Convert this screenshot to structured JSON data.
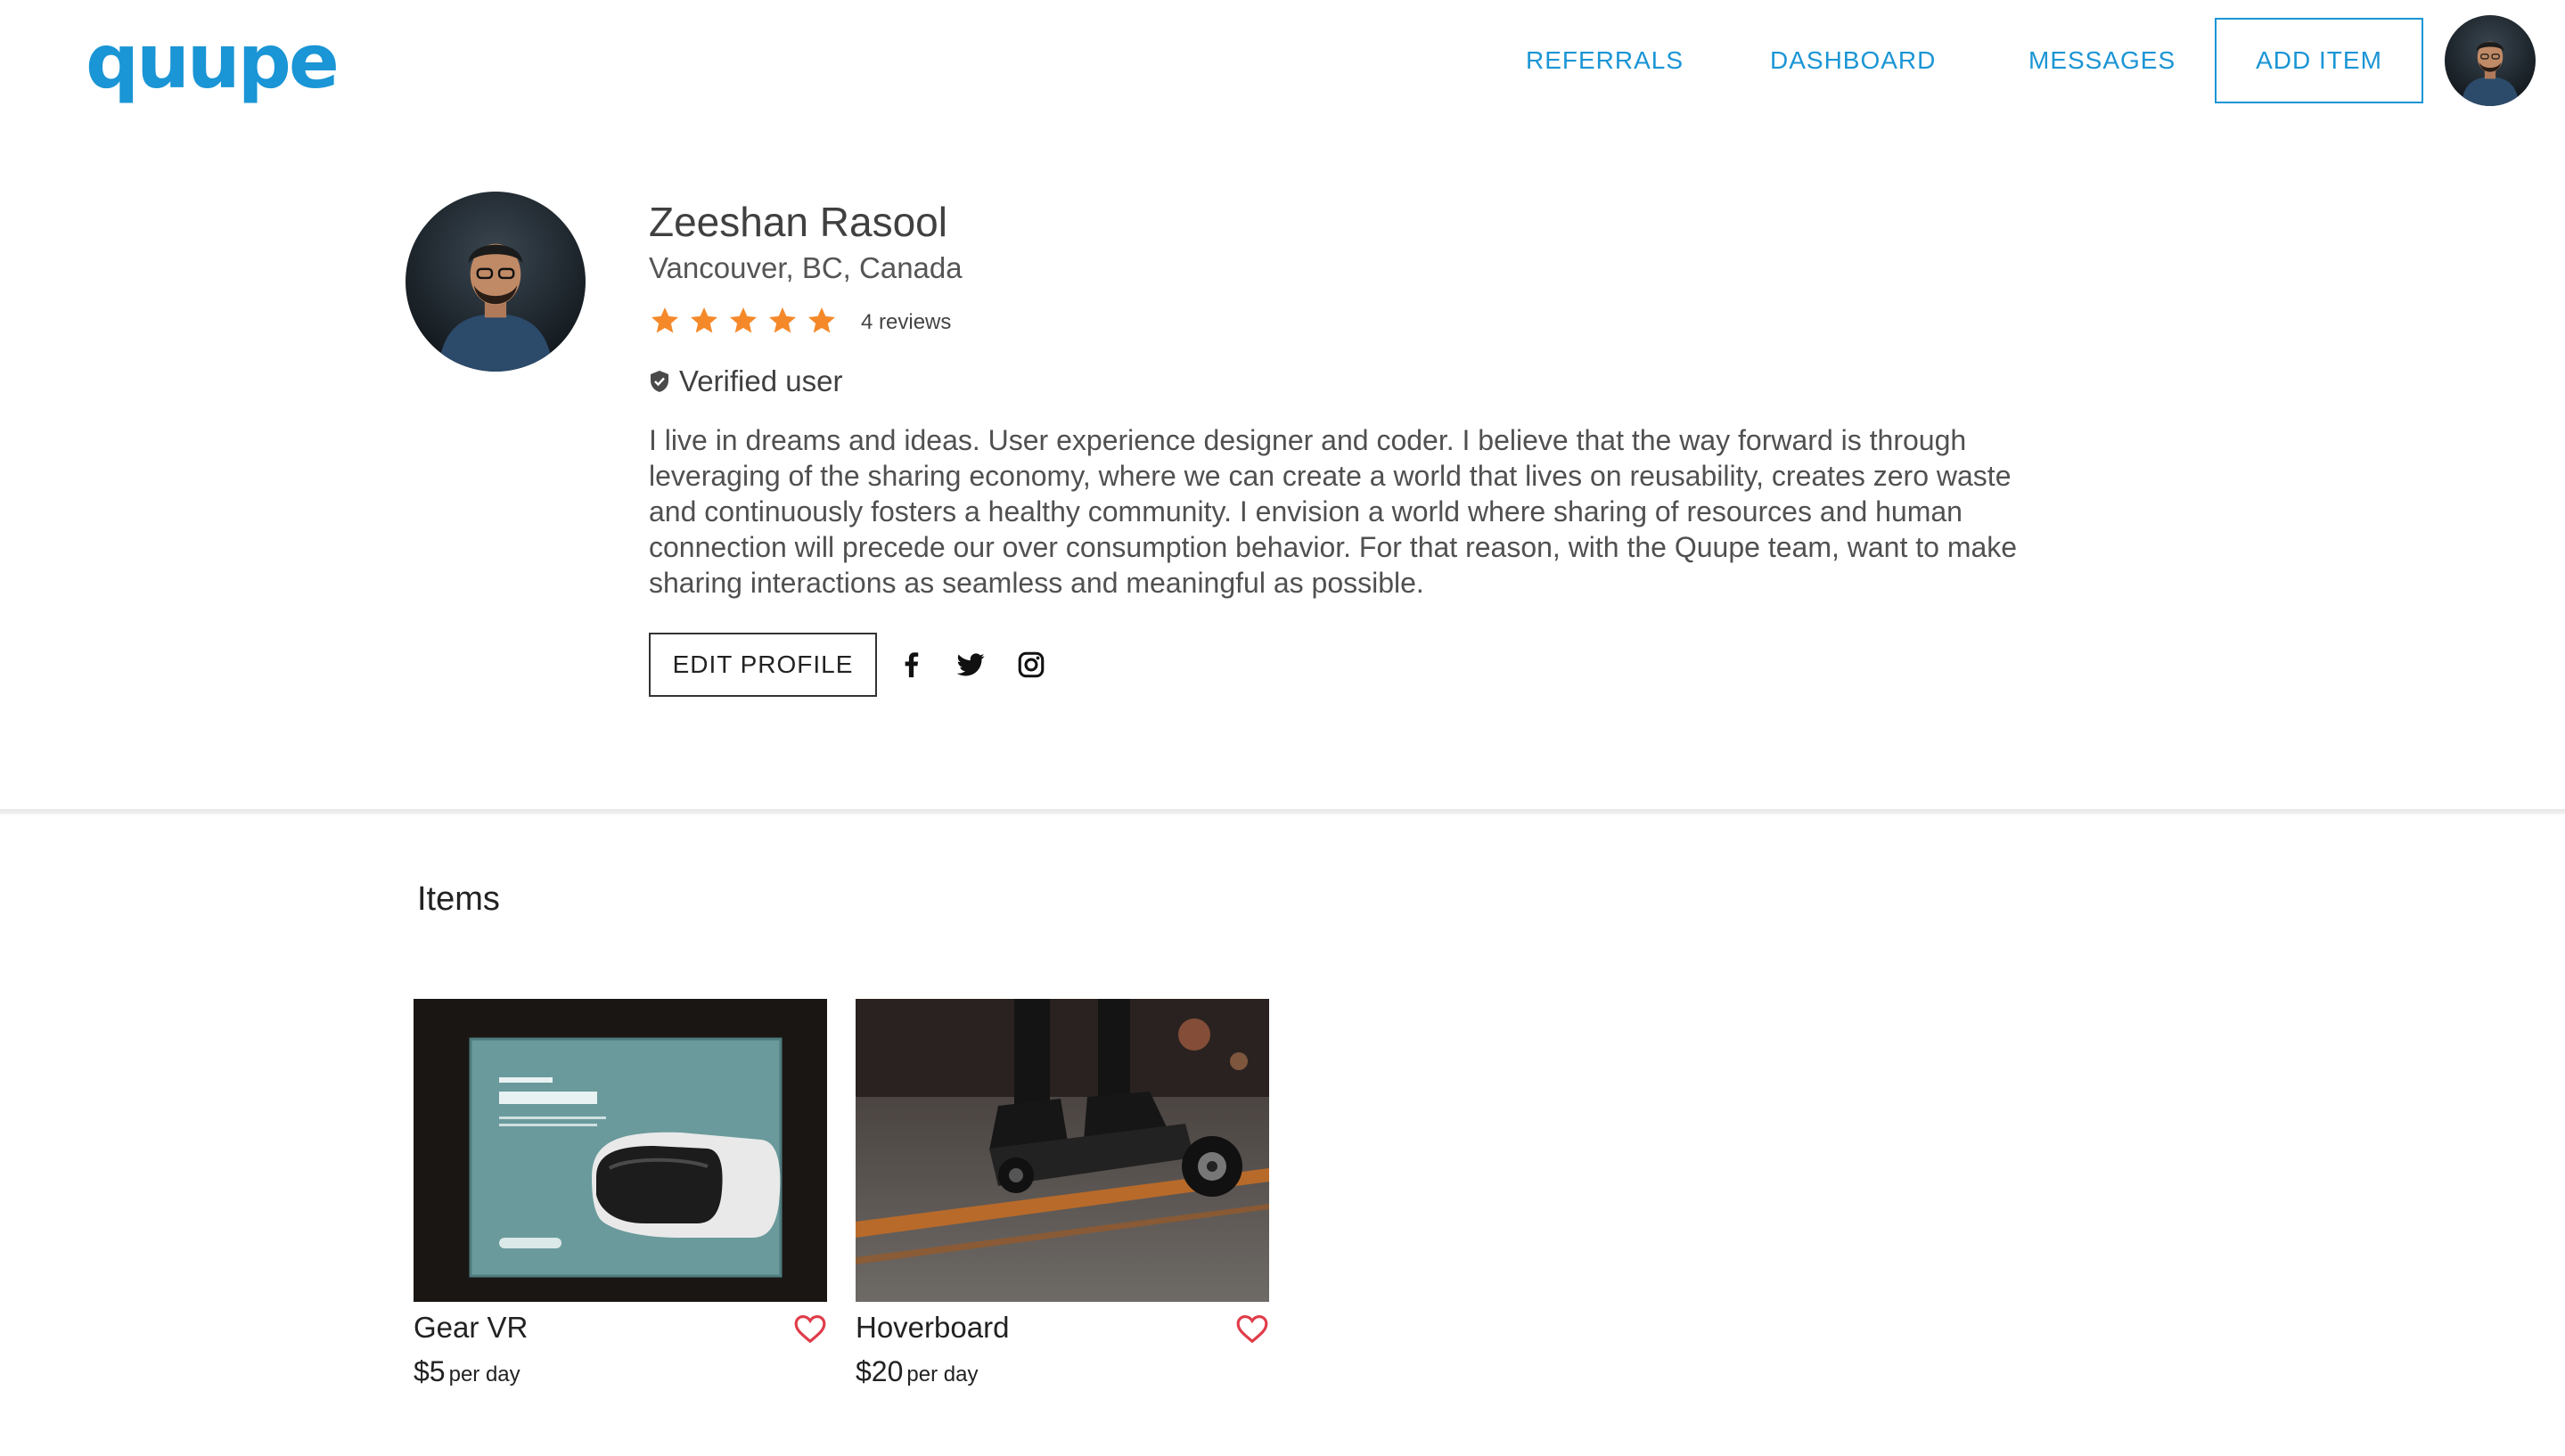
{
  "header": {
    "logo": "quupe",
    "nav": {
      "referrals": "REFERRALS",
      "dashboard": "DASHBOARD",
      "messages": "MESSAGES"
    },
    "add_item_label": "ADD ITEM",
    "avatar_icon": "user-avatar"
  },
  "profile": {
    "name": "Zeeshan Rasool",
    "location": "Vancouver, BC, Canada",
    "rating": 5,
    "reviews_label": "4 reviews",
    "verified_label": "Verified user",
    "bio": "I live in dreams and ideas. User experience designer and coder. I believe that the way forward is through leveraging of the sharing economy, where we can create a world that lives on reusability, creates zero waste and continuously fosters a healthy community. I envision a world where sharing of resources and human connection will precede our over consumption behavior. For that reason, with the Quupe team, want to make sharing interactions as seamless and meaningful as possible.",
    "edit_label": "EDIT PROFILE",
    "social_icons": [
      "facebook-icon",
      "twitter-icon",
      "instagram-icon"
    ]
  },
  "items_section": {
    "title": "Items",
    "items": [
      {
        "title": "Gear VR",
        "price": "$5",
        "unit": "per day",
        "image_icon": "gear-vr-box-photo"
      },
      {
        "title": "Hoverboard",
        "price": "$20",
        "unit": "per day",
        "image_icon": "hoverboard-photo"
      }
    ]
  },
  "colors": {
    "brand": "#1a95d5",
    "star": "#f5892a",
    "heart": "#e03c4a",
    "text": "#404040"
  }
}
